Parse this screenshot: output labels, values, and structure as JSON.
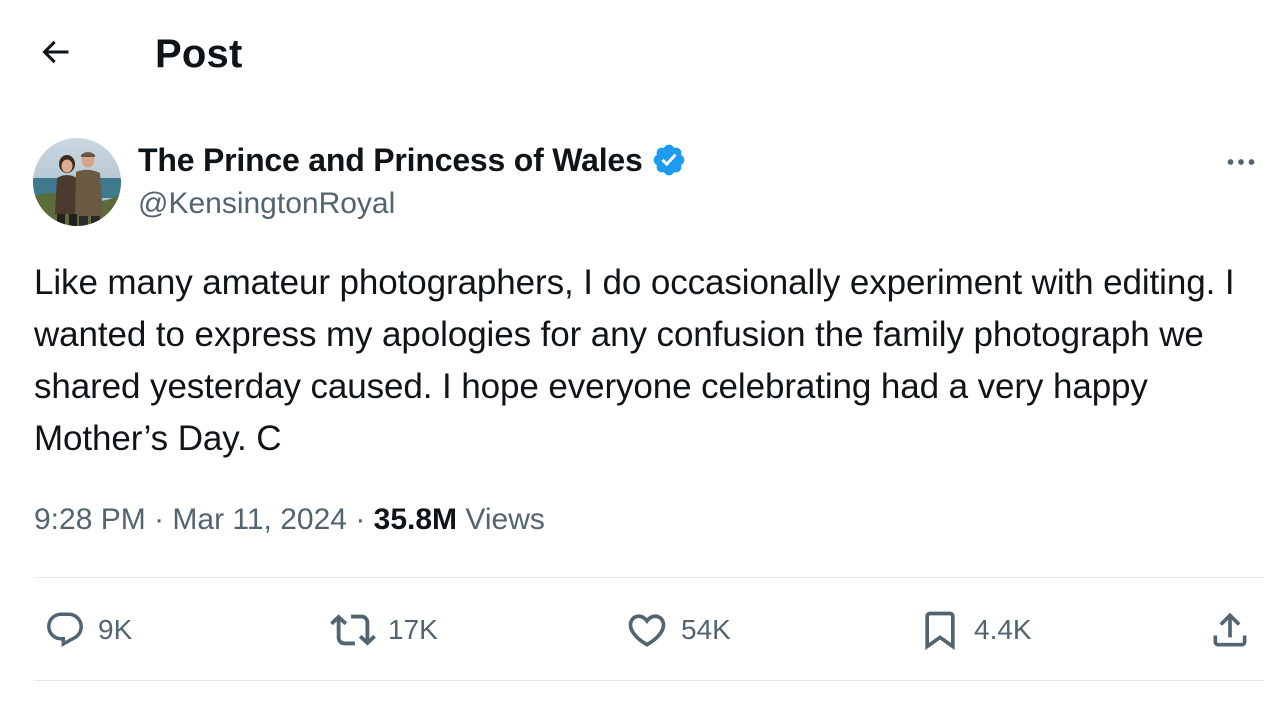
{
  "header": {
    "title": "Post",
    "back_icon": "arrow-left-icon"
  },
  "author": {
    "name": "The Prince and Princess of Wales",
    "handle": "@KensingtonRoyal",
    "verified_icon": "verified-badge-icon",
    "verified_color": "#1d9bf0"
  },
  "post": {
    "text": "Like many amateur photographers, I do occasionally experiment with editing. I wanted to express my apologies for any confusion the family photograph we shared yesterday caused. I hope everyone celebrating had a very happy Mother’s Day. C",
    "time": "9:28 PM",
    "date": "Mar 11, 2024",
    "views_count": "35.8M",
    "views_label": "Views"
  },
  "actions": {
    "reply_count": "9K",
    "repost_count": "17K",
    "like_count": "54K",
    "bookmark_count": "4.4K"
  },
  "colors": {
    "text_primary": "#0f1419",
    "text_secondary": "#536471",
    "accent": "#1d9bf0",
    "divider": "#e6e9ec"
  }
}
